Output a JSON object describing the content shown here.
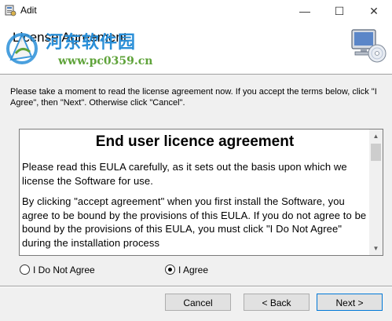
{
  "window": {
    "title": "Adit",
    "minimize_glyph": "—",
    "maximize_glyph": "☐",
    "close_glyph": "✕"
  },
  "header": {
    "title": "License Agreement",
    "watermark_cn": "河东软件园",
    "watermark_url": "www.pc0359.cn",
    "watermark_color": "#2a8fd8",
    "setup_icon": "computer-cd-icon"
  },
  "instructions": "Please take a moment to read the license agreement now. If you accept the terms below, click \"I Agree\", then \"Next\". Otherwise click \"Cancel\".",
  "eula": {
    "heading": "End user licence agreement",
    "paragraphs": [
      "Please read this EULA carefully, as it sets out the basis upon which we license the Software for use.",
      "By clicking \"accept agreement\" when you first install the Software, you agree to be bound by the provisions of this EULA. If you do not agree to be bound by the provisions of this EULA, you must click \"I Do Not Agree\" during the installation process"
    ]
  },
  "options": {
    "disagree_label": "I Do Not Agree",
    "agree_label": "I Agree",
    "selected": "agree"
  },
  "buttons": {
    "cancel": "Cancel",
    "back": "< Back",
    "next": "Next >"
  }
}
